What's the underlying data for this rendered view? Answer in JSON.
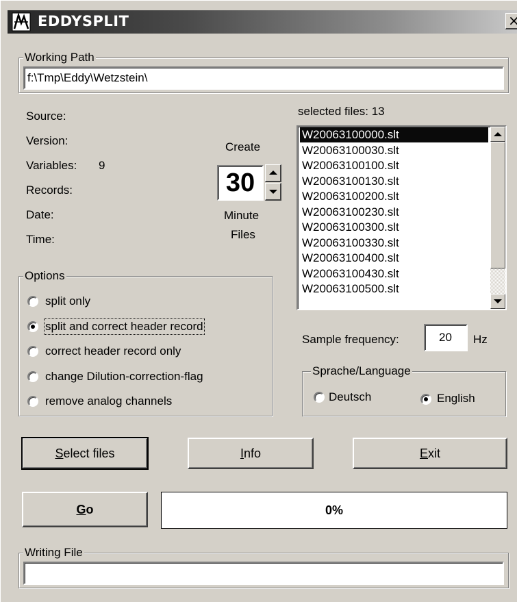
{
  "window": {
    "title": "EDDYSPLIT",
    "close_glyph": "×"
  },
  "working_path": {
    "legend": "Working Path",
    "value": "f:\\Tmp\\Eddy\\Wetzstein\\"
  },
  "info": {
    "source_label": "Source:",
    "version_label": "Version:",
    "variables_label": "Variables:",
    "variables_value": "9",
    "records_label": "Records:",
    "date_label": "Date:",
    "time_label": "Time:"
  },
  "create": {
    "top_label": "Create",
    "value": "30",
    "unit_label": "Minute",
    "bottom_label": "Files"
  },
  "files": {
    "selected_label": "selected files: 13",
    "items": [
      "W20063100000.slt",
      "W20063100030.slt",
      "W20063100100.slt",
      "W20063100130.slt",
      "W20063100200.slt",
      "W20063100230.slt",
      "W20063100300.slt",
      "W20063100330.slt",
      "W20063100400.slt",
      "W20063100430.slt",
      "W20063100500.slt"
    ],
    "selected_index": 0
  },
  "options": {
    "legend": "Options",
    "items": [
      {
        "label": "split only",
        "checked": false
      },
      {
        "label": "split and correct header record",
        "checked": true
      },
      {
        "label": "correct header record only",
        "checked": false
      },
      {
        "label": "change Dilution-correction-flag",
        "checked": false
      },
      {
        "label": "remove analog channels",
        "checked": false
      }
    ]
  },
  "sample": {
    "label": "Sample frequency:",
    "value": "20",
    "unit": "Hz"
  },
  "language": {
    "legend": "Sprache/Language",
    "deutsch_label": "Deutsch",
    "english_label": "English",
    "selected": "English"
  },
  "buttons": {
    "select_files_mnemonic": "S",
    "select_files_rest": "elect files",
    "info_mnemonic": "I",
    "info_rest": "nfo",
    "exit_mnemonic": "E",
    "exit_rest": "xit",
    "go_mnemonic": "G",
    "go_rest": "o"
  },
  "progress": {
    "text": "0%",
    "fraction": 0
  },
  "writing_file": {
    "legend": "Writing File",
    "value": ""
  },
  "colors": {
    "selection": "#0a0a0a",
    "face": "#d4d0c8",
    "progress_fill": "#000080"
  }
}
